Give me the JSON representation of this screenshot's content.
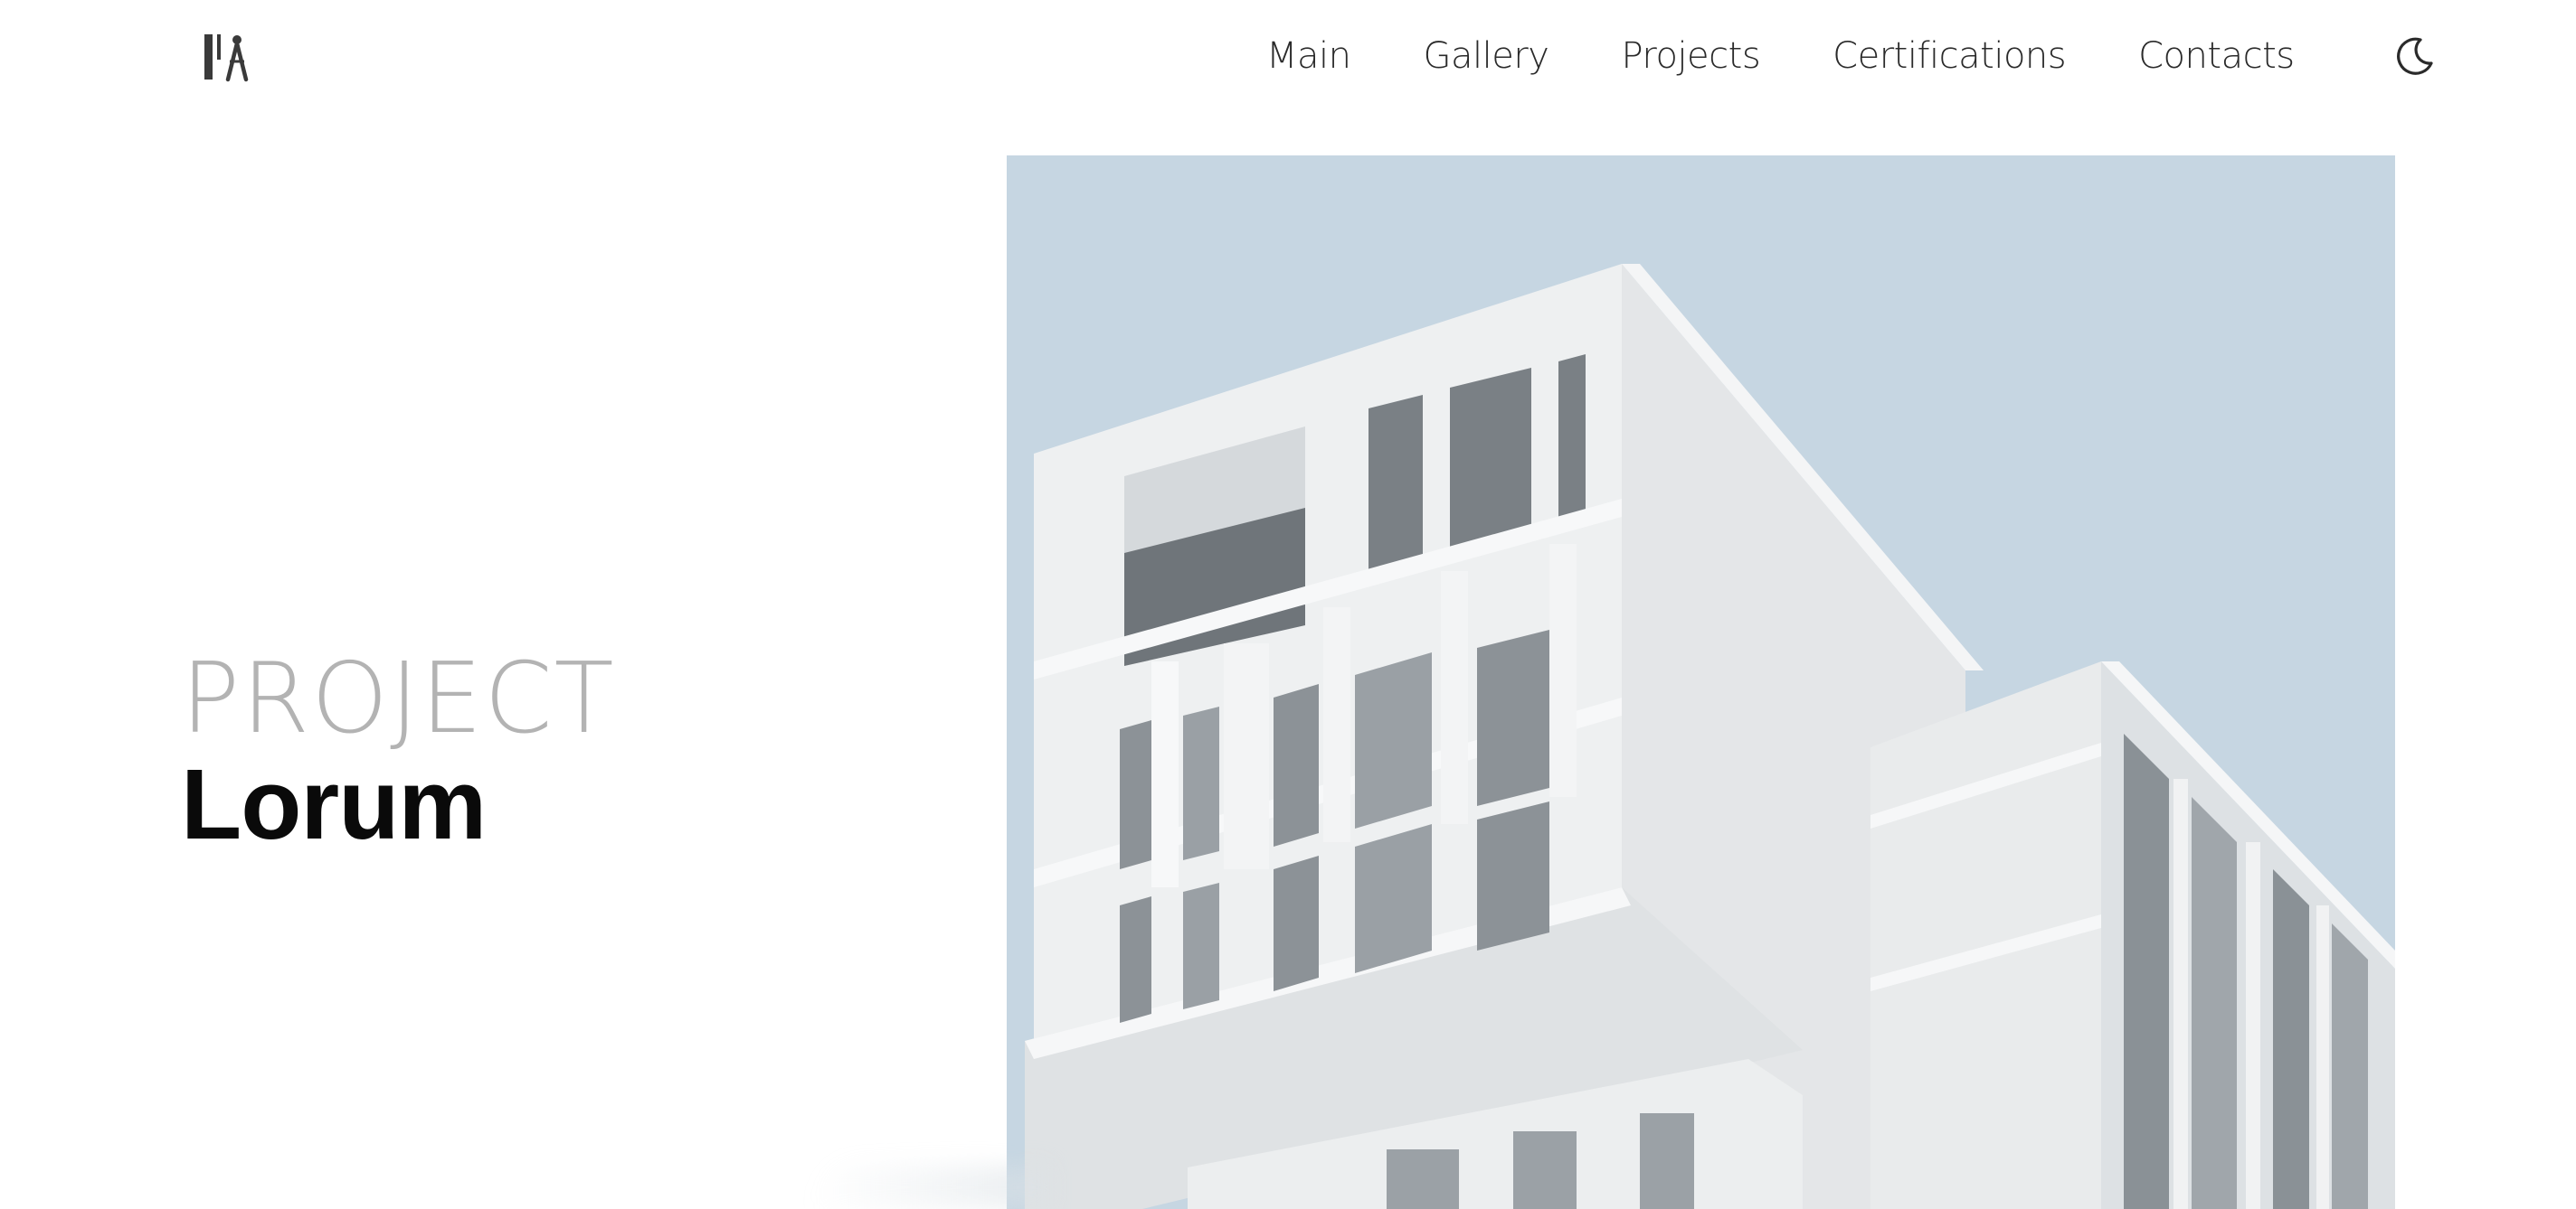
{
  "header": {
    "logo_icon": "architect-compass-logo",
    "nav": [
      {
        "label": "Main"
      },
      {
        "label": "Gallery"
      },
      {
        "label": "Projects"
      },
      {
        "label": "Certifications"
      },
      {
        "label": "Contacts"
      }
    ],
    "theme_toggle_icon": "moon-icon"
  },
  "hero": {
    "eyebrow": "PROJECT",
    "title": "Lorum",
    "image_icon": "building-photo"
  },
  "colors": {
    "background": "#ffffff",
    "nav_text": "#2a2a2a",
    "eyebrow_text": "#9a9a9a",
    "title_text": "#0a0a0a",
    "sky": "#c6d6e2"
  }
}
